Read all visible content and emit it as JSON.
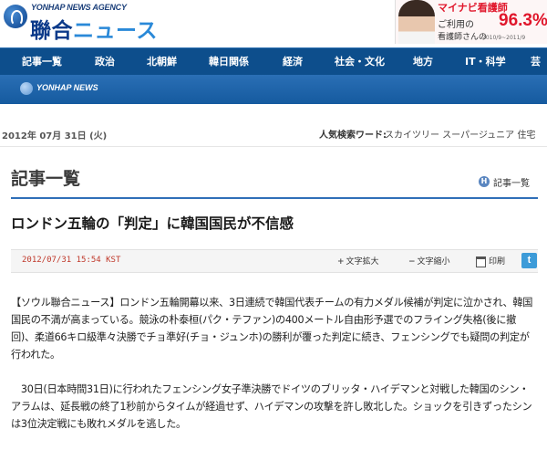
{
  "header": {
    "agency": "YONHAP NEWS AGENCY",
    "site_name_main": "聯合",
    "site_name_kana": "ニュース"
  },
  "ad": {
    "title": "マイナビ看護師",
    "line1": "ご利用の",
    "percent": "96.3%",
    "line2": "看護師さんの",
    "note": "2010/9~2011/9"
  },
  "nav": {
    "items": [
      "記事一覧",
      "政治",
      "北朝鮮",
      "韓日関係",
      "経済",
      "社会・文化",
      "地方",
      "IT・科学",
      "芸能"
    ]
  },
  "subbar": {
    "logo": "YONHAP NEWS"
  },
  "daterow": {
    "date": "2012年 07月 31日 (火)",
    "keyword_label": "人気検索ワード:",
    "keywords": "スカイツリー スーパージュニア 住宅"
  },
  "section": {
    "title": "記事一覧",
    "breadcrumb": "記事一覧"
  },
  "article": {
    "headline": "ロンドン五輪の「判定」に韓国国民が不信感",
    "datetime": "2012/07/31 15:54 KST",
    "tools": {
      "enlarge": "文字拡大",
      "shrink": "文字縮小",
      "print": "印刷",
      "twitter": "t"
    },
    "paragraphs": [
      "【ソウル聯合ニュース】ロンドン五輪開幕以来、3日連続で韓国代表チームの有力メダル候補が判定に泣かされ、韓国国民の不満が高まっている。競泳の朴泰桓(パク・テファン)の400メートル自由形予選でのフライング失格(後に撤回)、柔道66キロ級準々決勝でチョ準好(チョ・ジュンホ)の勝利が覆った判定に続き、フェンシングでも疑問の判定が行われた。",
      "　30日(日本時間31日)に行われたフェンシング女子準決勝でドイツのブリッタ・ハイデマンと対戦した韓国のシン・アラムは、延長戦の終了1秒前からタイムが経過せず、ハイデマンの攻撃を許し敗北した。ショックを引きずったシンは3位決定戦にも敗れメダルを逃した。"
    ]
  }
}
